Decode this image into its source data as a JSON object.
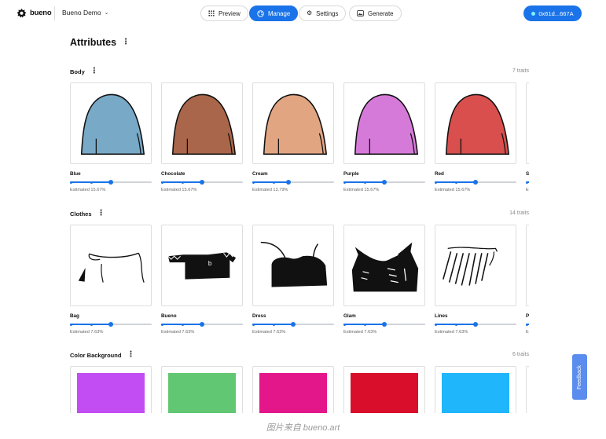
{
  "header": {
    "brand_name": "bueno",
    "project_name": "Bueno Demo",
    "nav": [
      {
        "label": "Preview",
        "icon": "grid-icon"
      },
      {
        "label": "Manage",
        "icon": "palette-icon"
      },
      {
        "label": "Settings",
        "icon": "gear-icon"
      },
      {
        "label": "Generate",
        "icon": "image-icon"
      }
    ],
    "wallet_address": "0x61d...667A",
    "accent_color": "#1a73e8"
  },
  "page": {
    "title": "Attributes"
  },
  "sections": [
    {
      "title": "Body",
      "count": "7 traits",
      "traits": [
        {
          "label": "Blue",
          "estimate": "Estimated 15.67%",
          "color": "#78a9c7",
          "level": 0.5
        },
        {
          "label": "Chocolate",
          "estimate": "Estimated 15.67%",
          "color": "#a9664a",
          "level": 0.5
        },
        {
          "label": "Cream",
          "estimate": "Estimated 13.79%",
          "color": "#e2a582",
          "level": 0.44
        },
        {
          "label": "Purple",
          "estimate": "Estimated 15.67%",
          "color": "#d57ad8",
          "level": 0.5
        },
        {
          "label": "Red",
          "estimate": "Estimated 15.67%",
          "color": "#d84f4e",
          "level": 0.5
        },
        {
          "label": "S",
          "estimate": "E",
          "color": "#ffffff",
          "level": 0.5
        }
      ]
    },
    {
      "title": "Clothes",
      "count": "14 traits",
      "traits": [
        {
          "label": "Bag",
          "estimate": "Estimated 7.63%",
          "level": 0.5
        },
        {
          "label": "Bueno",
          "estimate": "Estimated 7.63%",
          "level": 0.5
        },
        {
          "label": "Dress",
          "estimate": "Estimated 7.63%",
          "level": 0.5
        },
        {
          "label": "Glam",
          "estimate": "Estimated 7.63%",
          "level": 0.5
        },
        {
          "label": "Lines",
          "estimate": "Estimated 7.63%",
          "level": 0.5
        },
        {
          "label": "P",
          "estimate": "E",
          "level": 0.5
        }
      ]
    },
    {
      "title": "Color Background",
      "count": "6 traits",
      "traits": [
        {
          "color": "#c24df2"
        },
        {
          "color": "#62c772"
        },
        {
          "color": "#e4178a"
        },
        {
          "color": "#d90e2b"
        },
        {
          "color": "#1fb6fb"
        }
      ]
    }
  ],
  "feedback_label": "Feedback",
  "caption": "图片来自 bueno.art"
}
